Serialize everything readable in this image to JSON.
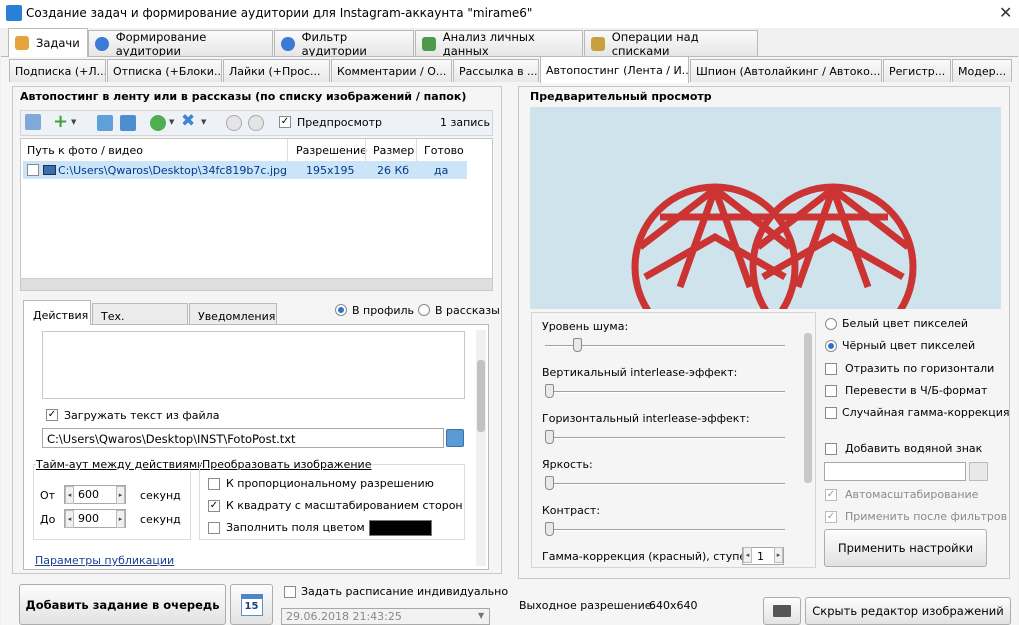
{
  "window": {
    "title": "Создание задач и формирование аудитории для Instagram-аккаунта \"mirame6\""
  },
  "main_tabs": [
    {
      "label": "Задачи",
      "color": "#e6a23c"
    },
    {
      "label": "Формирование аудитории",
      "color": "#3b7bd6"
    },
    {
      "label": "Фильтр аудитории",
      "color": "#3b7bd6"
    },
    {
      "label": "Анализ личных данных",
      "color": "#4d9a4d"
    },
    {
      "label": "Операции над списками",
      "color": "#c8a040"
    }
  ],
  "sub_tabs": [
    "Подписка (+Л...",
    "Отписка (+Блоки...",
    "Лайки (+Прос...",
    "Комментарии / О...",
    "Рассылка в ...",
    "Автопостинг (Лента / И...",
    "Шпион (Автолайкинг / Автоко...",
    "Регистр...",
    "Модер..."
  ],
  "left": {
    "header": "Автопостинг в ленту или в рассказы (по списку изображений / папок)",
    "toolbar": {
      "preview_label": "Предпросмотр",
      "preview_checked": true,
      "count": "1 запись"
    },
    "table": {
      "columns": [
        "Путь к фото / видео",
        "Разрешение",
        "Размер",
        "Готово"
      ],
      "rows": [
        {
          "path": "C:\\Users\\Qwaros\\Desktop\\34fc819b7c.jpg",
          "resolution": "195x195",
          "size": "26 Кб",
          "ready": "да"
        }
      ]
    },
    "inner_tabs": [
      "Действия",
      "Тех. настройки",
      "Уведомления"
    ],
    "target_profile": "В профиль",
    "target_stories": "В рассказы",
    "load_text": {
      "label": "Загружать текст из файла",
      "checked": true,
      "path": "C:\\Users\\Qwaros\\Desktop\\INST\\FotoPost.txt"
    },
    "timeout": {
      "title": "Тайм-аут между действиями",
      "from_label": "От",
      "from_value": "600",
      "to_label": "До",
      "to_value": "900",
      "unit": "секунд"
    },
    "transform": {
      "title": "Преобразовать изображение",
      "opt1": {
        "label": "К пропорциональному разрешению",
        "checked": false
      },
      "opt2": {
        "label": "К квадрату с масштабированием сторон",
        "checked": true
      },
      "opt3": {
        "label": "Заполнить поля цветом",
        "checked": false
      },
      "fill_color": "#000000"
    },
    "publish_params": "Параметры публикации",
    "add_button": "Добавить задание в очередь",
    "calendar_day": "15",
    "schedule": {
      "label": "Задать расписание индивидуально",
      "checked": false,
      "datetime": "29.06.2018 21:43:25"
    }
  },
  "right": {
    "header": "Предварительный просмотр",
    "sliders": [
      {
        "label": "Уровень шума:",
        "value": 0.12
      },
      {
        "label": "Вертикальный interlease-эффект:",
        "value": 0
      },
      {
        "label": "Горизонтальный interlease-эффект:",
        "value": 0
      },
      {
        "label": "Яркость:",
        "value": 0
      },
      {
        "label": "Контраст:",
        "value": 0
      }
    ],
    "gamma": {
      "label": "Гамма-коррекция (красный), ступени:",
      "value": "1"
    },
    "options": {
      "white_pixels": "Белый цвет пикселей",
      "black_pixels": "Чёрный цвет пикселей",
      "flip_h": "Отразить по горизонтали",
      "grayscale": "Перевести в Ч/Б-формат",
      "random_gamma": "Случайная гамма-коррекция",
      "watermark": "Добавить водяной знак",
      "autoscale": "Автомасштабирование",
      "after_filters": "Применить после фильтров"
    },
    "apply_button": "Применить настройки",
    "output_res": {
      "label": "Выходное разрешение:",
      "value": "640x640"
    },
    "hide_button": "Скрыть редактор изображений",
    "preview_bg": "#cfe3ec",
    "accent_red": "#cc3333"
  }
}
